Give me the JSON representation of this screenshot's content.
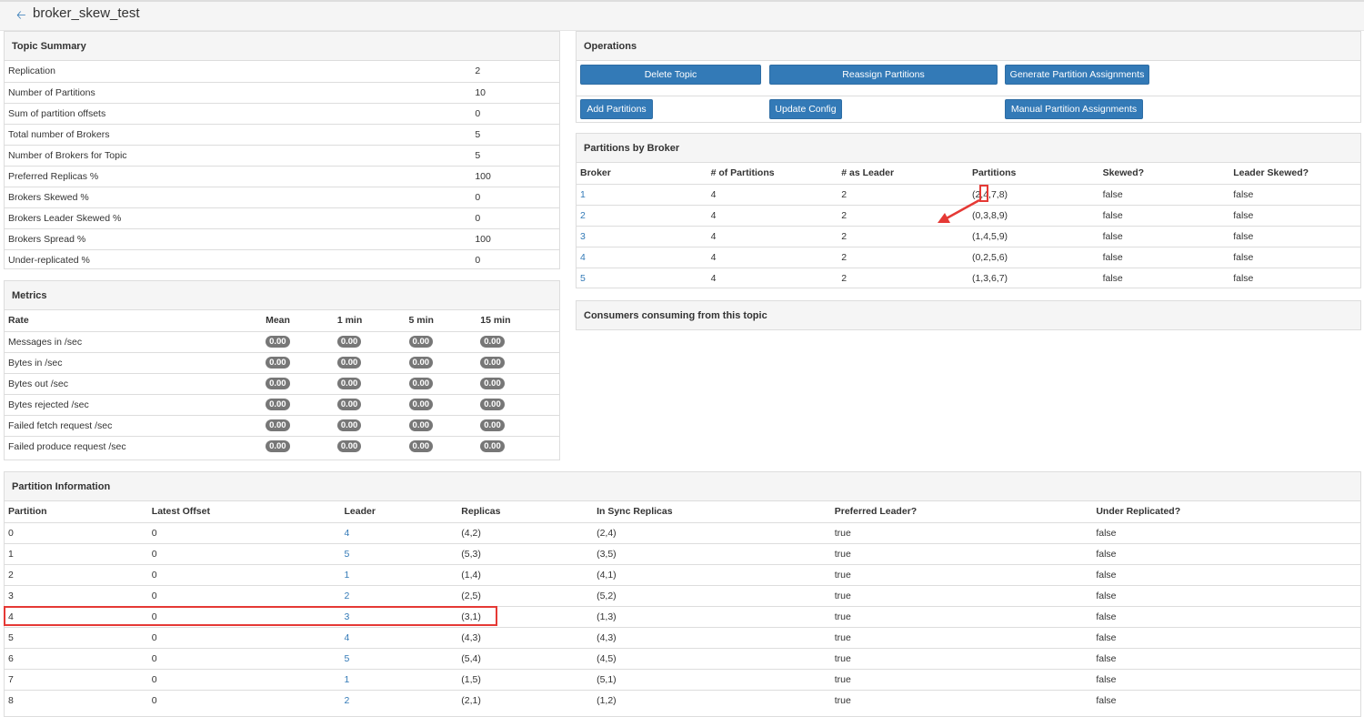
{
  "header": {
    "title": "broker_skew_test"
  },
  "topic_summary": {
    "title": "Topic Summary",
    "rows": [
      [
        "Replication",
        "2"
      ],
      [
        "Number of Partitions",
        "10"
      ],
      [
        "Sum of partition offsets",
        "0"
      ],
      [
        "Total number of Brokers",
        "5"
      ],
      [
        "Number of Brokers for Topic",
        "5"
      ],
      [
        "Preferred Replicas %",
        "100"
      ],
      [
        "Brokers Skewed %",
        "0"
      ],
      [
        "Brokers Leader Skewed %",
        "0"
      ],
      [
        "Brokers Spread %",
        "100"
      ],
      [
        "Under-replicated %",
        "0"
      ]
    ]
  },
  "metrics": {
    "title": "Metrics",
    "headers": [
      "Rate",
      "Mean",
      "1 min",
      "5 min",
      "15 min"
    ],
    "rows": [
      [
        "Messages in /sec",
        "0.00",
        "0.00",
        "0.00",
        "0.00"
      ],
      [
        "Bytes in /sec",
        "0.00",
        "0.00",
        "0.00",
        "0.00"
      ],
      [
        "Bytes out /sec",
        "0.00",
        "0.00",
        "0.00",
        "0.00"
      ],
      [
        "Bytes rejected /sec",
        "0.00",
        "0.00",
        "0.00",
        "0.00"
      ],
      [
        "Failed fetch request /sec",
        "0.00",
        "0.00",
        "0.00",
        "0.00"
      ],
      [
        "Failed produce request /sec",
        "0.00",
        "0.00",
        "0.00",
        "0.00"
      ]
    ]
  },
  "operations": {
    "title": "Operations",
    "buttons": [
      "Delete Topic",
      "Reassign Partitions",
      "Generate Partition Assignments",
      "Add Partitions",
      "Update Config",
      "Manual Partition Assignments"
    ]
  },
  "partitions_by_broker": {
    "title": "Partitions by Broker",
    "headers": [
      "Broker",
      "# of Partitions",
      "# as Leader",
      "Partitions",
      "Skewed?",
      "Leader Skewed?"
    ],
    "rows": [
      [
        "1",
        "4",
        "2",
        "(2,4,7,8)",
        "false",
        "false"
      ],
      [
        "2",
        "4",
        "2",
        "(0,3,8,9)",
        "false",
        "false"
      ],
      [
        "3",
        "4",
        "2",
        "(1,4,5,9)",
        "false",
        "false"
      ],
      [
        "4",
        "4",
        "2",
        "(0,2,5,6)",
        "false",
        "false"
      ],
      [
        "5",
        "4",
        "2",
        "(1,3,6,7)",
        "false",
        "false"
      ]
    ]
  },
  "consumers": {
    "title": "Consumers consuming from this topic"
  },
  "partition_info": {
    "title": "Partition Information",
    "headers": [
      "Partition",
      "Latest Offset",
      "Leader",
      "Replicas",
      "In Sync Replicas",
      "Preferred Leader?",
      "Under Replicated?"
    ],
    "rows": [
      [
        "0",
        "0",
        "4",
        "(4,2)",
        "(2,4)",
        "true",
        "false"
      ],
      [
        "1",
        "0",
        "5",
        "(5,3)",
        "(3,5)",
        "true",
        "false"
      ],
      [
        "2",
        "0",
        "1",
        "(1,4)",
        "(4,1)",
        "true",
        "false"
      ],
      [
        "3",
        "0",
        "2",
        "(2,5)",
        "(5,2)",
        "true",
        "false"
      ],
      [
        "4",
        "0",
        "3",
        "(3,1)",
        "(1,3)",
        "true",
        "false"
      ],
      [
        "5",
        "0",
        "4",
        "(4,3)",
        "(4,3)",
        "true",
        "false"
      ],
      [
        "6",
        "0",
        "5",
        "(5,4)",
        "(4,5)",
        "true",
        "false"
      ],
      [
        "7",
        "0",
        "1",
        "(1,5)",
        "(5,1)",
        "true",
        "false"
      ],
      [
        "8",
        "0",
        "2",
        "(2,1)",
        "(1,2)",
        "true",
        "false"
      ]
    ]
  },
  "colors": {
    "link": "#337ab7",
    "button": "#337ab7",
    "annotation": "#e53935",
    "badge": "#777777"
  }
}
